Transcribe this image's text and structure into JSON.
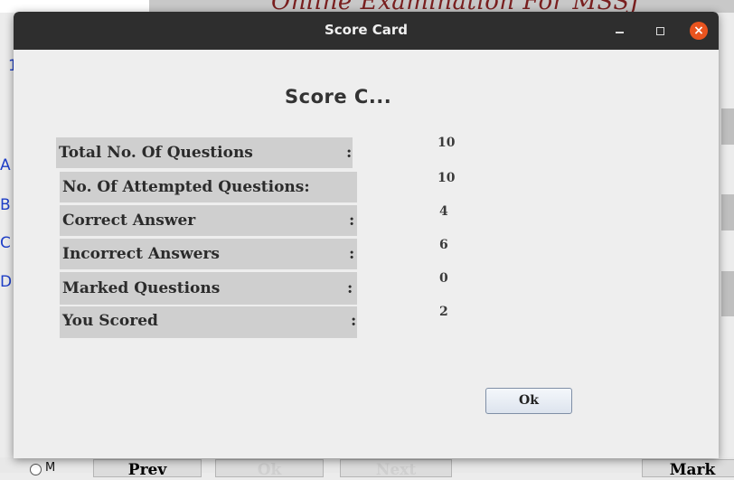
{
  "background": {
    "heading": "Online Examination For MSSJ",
    "row_number": "1",
    "option_letters": [
      "A",
      "B",
      "C",
      "D"
    ],
    "radio_label": "M",
    "buttons": {
      "prev": "Prev",
      "ok": "Ok",
      "next": "Next",
      "mark": "Mark"
    }
  },
  "dialog": {
    "title": "Score Card",
    "heading": "Score C...",
    "rows": [
      {
        "label": "Total No. Of Questions",
        "value": "10"
      },
      {
        "label": "No. Of Attempted Questions:",
        "value": "10"
      },
      {
        "label": "Correct Answer",
        "value": "4"
      },
      {
        "label": "Incorrect Answers",
        "value": "6"
      },
      {
        "label": "Marked Questions",
        "value": "0"
      },
      {
        "label": "You Scored",
        "value": "2"
      }
    ],
    "colon": ":",
    "ok_label": "Ok",
    "close_glyph": "×"
  },
  "colors": {
    "titlebar": "#2e2e2e",
    "close_button": "#e9541f",
    "label_bg": "#cfcfcf",
    "option_letters": "#1f3fc8",
    "background_heading": "#7a1f1f"
  }
}
